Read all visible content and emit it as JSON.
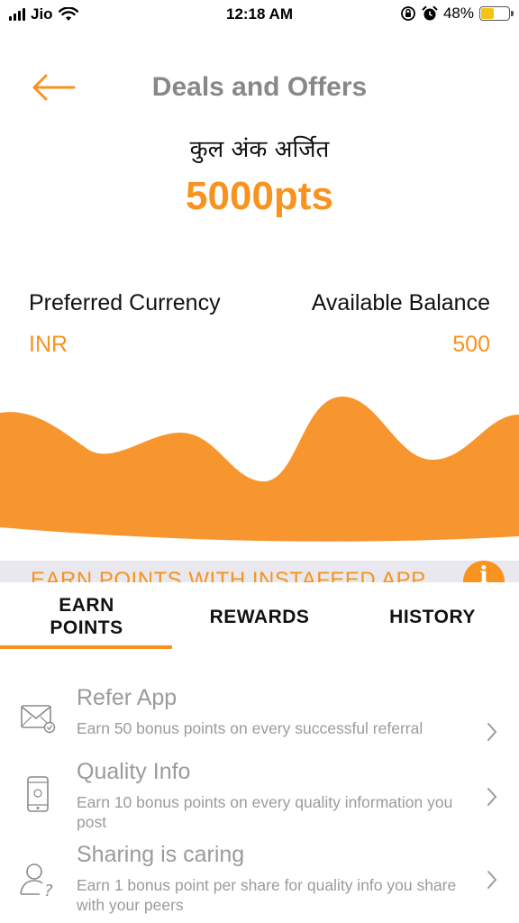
{
  "status_bar": {
    "carrier": "Jio",
    "time": "12:18 AM",
    "battery_percent": "48%",
    "battery_level": 0.48,
    "icons": [
      "signal-icon",
      "wifi-icon",
      "rotation-lock-icon",
      "alarm-icon",
      "battery-icon"
    ]
  },
  "header": {
    "title": "Deals and Offers",
    "back_icon": "arrow-left-icon"
  },
  "points": {
    "label": "कुल अंक अर्जित",
    "value": "5000pts"
  },
  "balance": {
    "currency_label": "Preferred Currency",
    "currency_value": "INR",
    "balance_label": "Available Balance",
    "balance_value": "500"
  },
  "banner": {
    "text": "EARN POINTS WITH INSTAFEED APP",
    "info_icon": "info-icon"
  },
  "tabs": [
    {
      "label": "EARN POINTS",
      "active": true
    },
    {
      "label": "REWARDS",
      "active": false
    },
    {
      "label": "HISTORY",
      "active": false
    }
  ],
  "items": [
    {
      "title": "Refer App",
      "description": "Earn 50 bonus points on every successful referral",
      "icon": "envelope-check-icon"
    },
    {
      "title": "Quality Info",
      "description": "Earn 10 bonus points on every quality information you post",
      "icon": "mobile-phone-icon"
    },
    {
      "title": "Sharing is caring",
      "description": "Earn 1 bonus point per share for quality info you share with your peers",
      "icon": "user-question-icon"
    }
  ],
  "colors": {
    "accent": "#f7931e",
    "muted_text": "#9b9b9b",
    "title_gray": "#888888",
    "banner_bg": "#e8e8ee"
  }
}
